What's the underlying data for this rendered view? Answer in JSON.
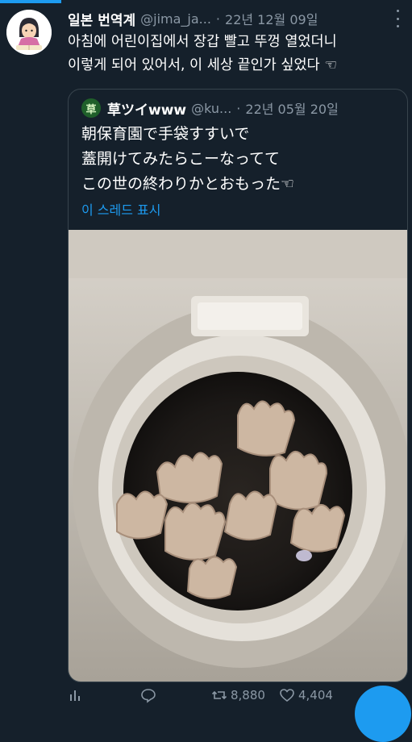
{
  "tweet": {
    "author_name": "일본 번역계",
    "author_handle": "@jima_ja...",
    "separator": "·",
    "date": "22년 12월 09일",
    "text_lines": [
      "아침에 어린이집에서 장갑 빨고 뚜껑 열었더니",
      "이렇게 되어 있어서, 이 세상 끝인가 싶었다 ☜"
    ]
  },
  "quote": {
    "avatar_glyph": "草",
    "author_name": "草ツイwww",
    "author_handle": "@ku...",
    "separator": "·",
    "date": "22년 05월 20일",
    "text_lines": [
      "朝保育園で手袋すすいで",
      "蓋開けてみたらこーなってて",
      "この世の終わりかとおもった☜"
    ],
    "thread_link": "이 스레드 표시"
  },
  "actions": {
    "retweet_count": "8,880",
    "like_count": "4,404"
  },
  "colors": {
    "background": "#15202b",
    "accent": "#1d9bf0",
    "muted": "#8b98a5",
    "border": "#38444d"
  },
  "icons": [
    "more-vertical-icon",
    "analytics-icon",
    "reply-icon",
    "retweet-icon",
    "like-icon"
  ]
}
